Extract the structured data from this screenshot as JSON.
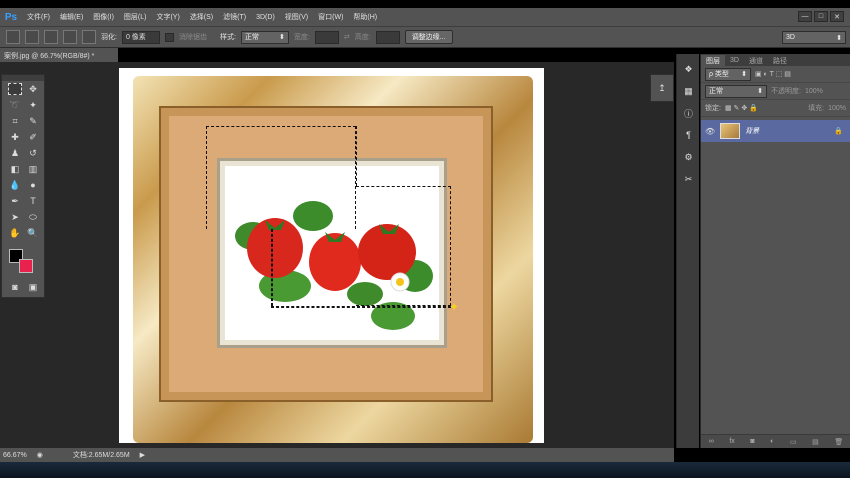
{
  "app": {
    "logo": "Ps",
    "accent": "#3aa0ff"
  },
  "menu": [
    "文件(F)",
    "编辑(E)",
    "图像(I)",
    "图层(L)",
    "文字(Y)",
    "选择(S)",
    "滤镜(T)",
    "3D(D)",
    "视图(V)",
    "窗口(W)",
    "帮助(H)"
  ],
  "window_buttons": [
    "—",
    "□",
    "✕"
  ],
  "options": {
    "feather_label": "羽化:",
    "feather_value": "0 像素",
    "antialias_label": "消除锯齿",
    "style_label": "样式:",
    "style_value": "正常",
    "width_label": "宽度:",
    "height_label": "高度:",
    "refine_button": "调整边缘...",
    "workspace": "3D"
  },
  "document": {
    "tab_title": "案例.jpg @ 66.7%(RGB/8#) *"
  },
  "tools": {
    "colors": {
      "foreground": "#000000",
      "background": "#e8214d"
    }
  },
  "layers_panel": {
    "tabs": [
      "图层",
      "3D",
      "通道",
      "路径"
    ],
    "filter_label": "ρ 类型",
    "blend_mode": "正常",
    "opacity_label": "不透明度:",
    "opacity_value": "100%",
    "lock_label": "锁定:",
    "fill_label": "填充:",
    "fill_value": "100%",
    "layer_name": "背景",
    "bottom_icons": [
      "∞",
      "fx",
      "◙",
      "◐",
      "▭",
      "▤",
      "🗑"
    ]
  },
  "status": {
    "zoom": "66.67%",
    "doc_info": "文档:2.65M/2.65M"
  }
}
